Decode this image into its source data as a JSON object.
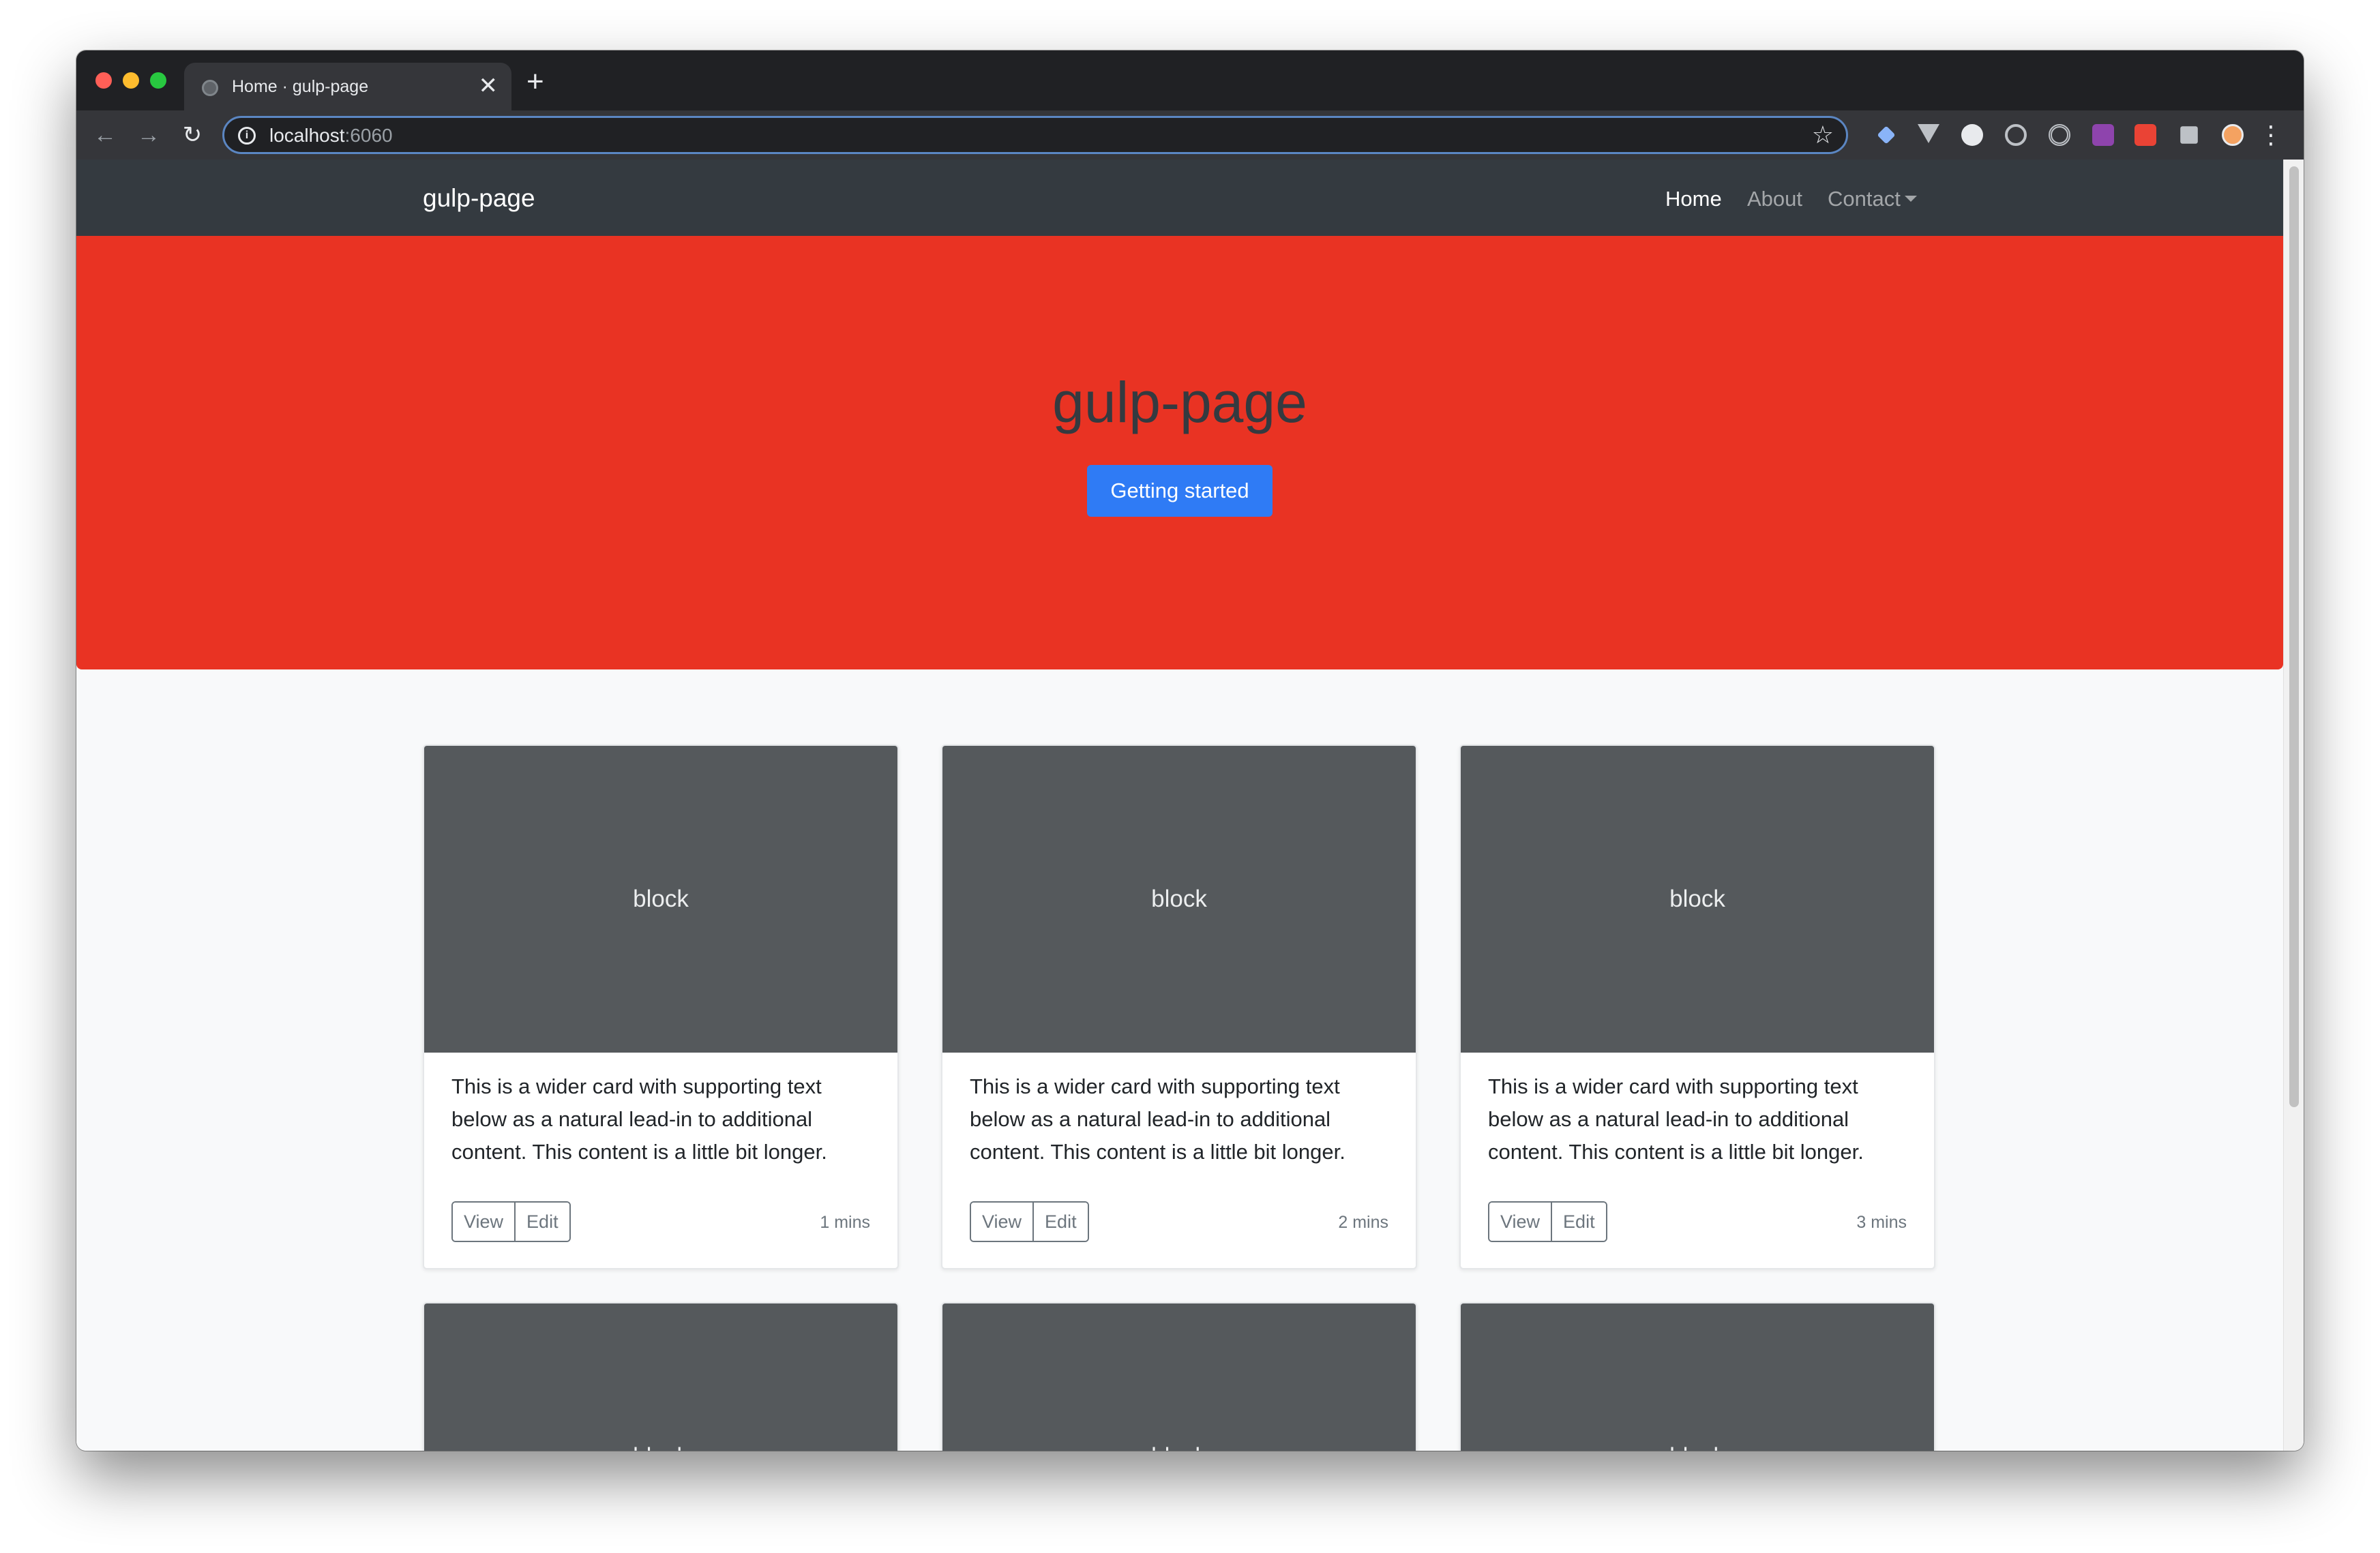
{
  "browser": {
    "tab_title": "Home · gulp-page",
    "tab_close": "✕",
    "new_tab": "+",
    "url_host": "localhost",
    "url_port": ":6060"
  },
  "navbar": {
    "brand": "gulp-page",
    "links": [
      {
        "label": "Home",
        "active": true
      },
      {
        "label": "About",
        "active": false
      },
      {
        "label": "Contact",
        "active": false
      }
    ]
  },
  "hero": {
    "title": "gulp-page",
    "button": "Getting started",
    "background": "#e93323"
  },
  "cards": [
    {
      "image_label": "block",
      "text": "This is a wider card with supporting text below as a natural lead-in to additional content. This content is a little bit longer.",
      "view": "View",
      "edit": "Edit",
      "time": "1 mins"
    },
    {
      "image_label": "block",
      "text": "This is a wider card with supporting text below as a natural lead-in to additional content. This content is a little bit longer.",
      "view": "View",
      "edit": "Edit",
      "time": "2 mins"
    },
    {
      "image_label": "block",
      "text": "This is a wider card with supporting text below as a natural lead-in to additional content. This content is a little bit longer.",
      "view": "View",
      "edit": "Edit",
      "time": "3 mins"
    },
    {
      "image_label": "block"
    },
    {
      "image_label": "block"
    },
    {
      "image_label": "block"
    }
  ],
  "colors": {
    "navbar": "#343a40",
    "primary_button": "#2f7bf5",
    "card_image": "#55595c"
  }
}
